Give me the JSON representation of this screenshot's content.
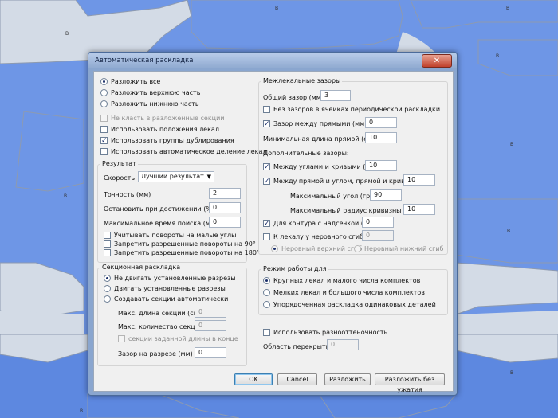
{
  "window": {
    "title": "Автоматическая раскладка",
    "close_glyph": "✕"
  },
  "layout_mode": {
    "options": [
      "Разложить все",
      "Разложить верхнюю часть",
      "Разложить нижнюю часть"
    ],
    "selected": 0
  },
  "top_checks": [
    {
      "label": "Не класть в разложенные секции",
      "checked": false,
      "disabled": true
    },
    {
      "label": "Использовать положения лекал",
      "checked": false,
      "disabled": false
    },
    {
      "label": "Использовать группы дублирования",
      "checked": true,
      "disabled": false
    },
    {
      "label": "Использовать автоматическое деление лекал",
      "checked": false,
      "disabled": false
    }
  ],
  "result": {
    "title": "Результат",
    "speed_label": "Скорость",
    "speed_value": "Лучший результат",
    "accuracy_label": "Точность (мм)",
    "accuracy_value": "2",
    "stop_label": "Остановить при достижении (%)",
    "stop_value": "0",
    "max_time_label": "Максимальное время поиска (мин)",
    "max_time_value": "0",
    "checks": [
      {
        "label": "Учитывать повороты на малые углы",
        "checked": false
      },
      {
        "label": "Запретить разрешенные повороты на 90°",
        "checked": false
      },
      {
        "label": "Запретить разрешенные повороты на 180°",
        "checked": false
      }
    ]
  },
  "section": {
    "title": "Секционная раскладка",
    "options": [
      "Не двигать установленные разрезы",
      "Двигать установленные разрезы",
      "Создавать секции автоматически"
    ],
    "selected": 0,
    "max_len_label": "Макс. длина секции (см)",
    "max_len_value": "0",
    "max_count_label": "Макс. количество секций",
    "max_count_value": "0",
    "end_check_label": "секции заданной длины в конце",
    "gap_label": "Зазор на разрезе (мм)",
    "gap_value": "0"
  },
  "gaps": {
    "title": "Межлекальные зазоры",
    "total_label": "Общий зазор (мм)",
    "total_value": "3",
    "no_gap_label": "Без зазоров в ячейках периодической раскладки",
    "straight_label": "Зазор между прямыми (мм)",
    "straight_value": "0",
    "min_len_label": "Минимальная длина прямой (см)",
    "min_len_value": "10",
    "extra_title": "Дополнительные зазоры:",
    "angles_label": "Между углами и кривыми (мм)",
    "angles_value": "10",
    "line_label": "Между прямой и углом, прямой и кривой (мм)",
    "line_value": "10",
    "max_angle_label": "Максимальный угол (град)",
    "max_angle_value": "90",
    "max_radius_label": "Максимальный радиус кривизны (см)",
    "max_radius_value": "10",
    "notch_label": "Для контура с надсечкой (мм)",
    "notch_value": "0",
    "fold_label": "К лекалу у неровного сгиба",
    "fold_value": "0",
    "fold_top": "Неровный верхний сгиб",
    "fold_bottom": "Неровный нижний сгиб"
  },
  "mode": {
    "title": "Режим работы для",
    "options": [
      "Крупных лекал и малого числа комплектов",
      "Мелких лекал и большого числа комплектов",
      "Упорядоченная раскладка одинаковых деталей"
    ],
    "selected": 0
  },
  "shade": {
    "label": "Использовать разнооттеночность",
    "overlap_label": "Область перекрытия",
    "overlap_value": "0"
  },
  "buttons": {
    "ok": "OK",
    "cancel": "Cancel",
    "layout": "Разложить",
    "layout_no_compress": "Разложить без ужатия"
  },
  "background": {
    "piece_marks": [
      "B",
      "B",
      "B",
      "B",
      "B",
      "B",
      "B",
      "B",
      "B"
    ]
  },
  "colors": {
    "canvas_blue": "#6e96e6",
    "piece_gray": "#d3dbe6"
  }
}
